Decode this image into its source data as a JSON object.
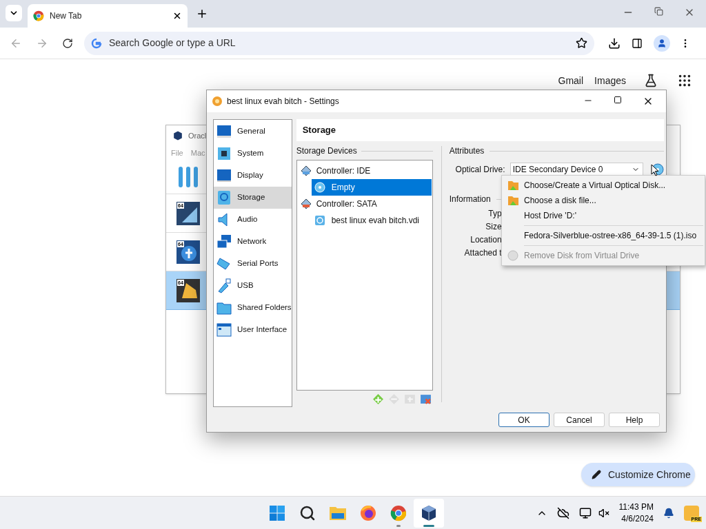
{
  "browser": {
    "tab": {
      "title": "New Tab"
    },
    "address": {
      "placeholder": "Search Google or type a URL"
    },
    "top_links": [
      "Gmail",
      "Images"
    ],
    "customize_button": "Customize Chrome"
  },
  "background_window": {
    "title": "Oracl",
    "menu": [
      "File",
      "Mac"
    ],
    "vms": [
      {
        "badge": "64",
        "kind": "windows",
        "selected": false
      },
      {
        "badge": "64",
        "kind": "fedora",
        "selected": false
      },
      {
        "badge": "64",
        "kind": "linux",
        "selected": true
      }
    ]
  },
  "dialog": {
    "title": "best linux evah bitch - Settings",
    "sections": [
      {
        "label": "General",
        "selected": false
      },
      {
        "label": "System",
        "selected": false
      },
      {
        "label": "Display",
        "selected": false
      },
      {
        "label": "Storage",
        "selected": true
      },
      {
        "label": "Audio",
        "selected": false
      },
      {
        "label": "Network",
        "selected": false
      },
      {
        "label": "Serial Ports",
        "selected": false
      },
      {
        "label": "USB",
        "selected": false
      },
      {
        "label": "Shared Folders",
        "selected": false
      },
      {
        "label": "User Interface",
        "selected": false
      }
    ],
    "page_title": "Storage",
    "devices_heading": "Storage Devices",
    "tree": [
      {
        "label": "Controller: IDE",
        "kind": "controller",
        "selected": false,
        "children": [
          {
            "label": "Empty",
            "kind": "optical",
            "selected": true
          }
        ]
      },
      {
        "label": "Controller: SATA",
        "kind": "controller",
        "selected": false,
        "children": [
          {
            "label": "best linux evah bitch.vdi",
            "kind": "disk",
            "selected": false
          }
        ]
      }
    ],
    "tree_tools": [
      {
        "kind": "add",
        "disabled": false
      },
      {
        "kind": "remove",
        "disabled": true
      },
      {
        "kind": "add-attachment",
        "disabled": true
      },
      {
        "kind": "remove-attachment",
        "disabled": false
      }
    ],
    "attributes_heading": "Attributes",
    "optical_drive": {
      "label": "Optical Drive:",
      "value": "IDE Secondary Device 0"
    },
    "information_heading": "Information",
    "info_labels": [
      "Typ",
      "Size",
      "Location",
      "Attached t"
    ],
    "buttons": [
      {
        "label": "OK",
        "default": true
      },
      {
        "label": "Cancel",
        "default": false
      },
      {
        "label": "Help",
        "default": false
      }
    ]
  },
  "popup_menu": {
    "items": [
      {
        "kind": "item",
        "label": "Choose/Create a Virtual Optical Disk...",
        "icon": true,
        "disabled": false
      },
      {
        "kind": "item",
        "label": "Choose a disk file...",
        "icon": true,
        "disabled": false
      },
      {
        "kind": "item",
        "label": "Host Drive 'D:'",
        "icon": false,
        "disabled": false
      },
      {
        "kind": "separator"
      },
      {
        "kind": "item",
        "label": "Fedora-Silverblue-ostree-x86_64-39-1.5 (1).iso",
        "icon": false,
        "disabled": false
      },
      {
        "kind": "separator"
      },
      {
        "kind": "item",
        "label": "Remove Disk from Virtual Drive",
        "icon": true,
        "disabled": true
      }
    ]
  },
  "taskbar": {
    "apps": [
      {
        "kind": "start",
        "running": false,
        "active": false
      },
      {
        "kind": "search",
        "running": false,
        "active": false
      },
      {
        "kind": "files",
        "running": false,
        "active": false
      },
      {
        "kind": "firefox",
        "running": false,
        "active": false
      },
      {
        "kind": "chrome",
        "running": true,
        "active": false
      },
      {
        "kind": "virtualbox",
        "running": true,
        "active": true
      }
    ],
    "time": "11:43 PM",
    "date": "4/6/2024",
    "badge": "PRE"
  }
}
